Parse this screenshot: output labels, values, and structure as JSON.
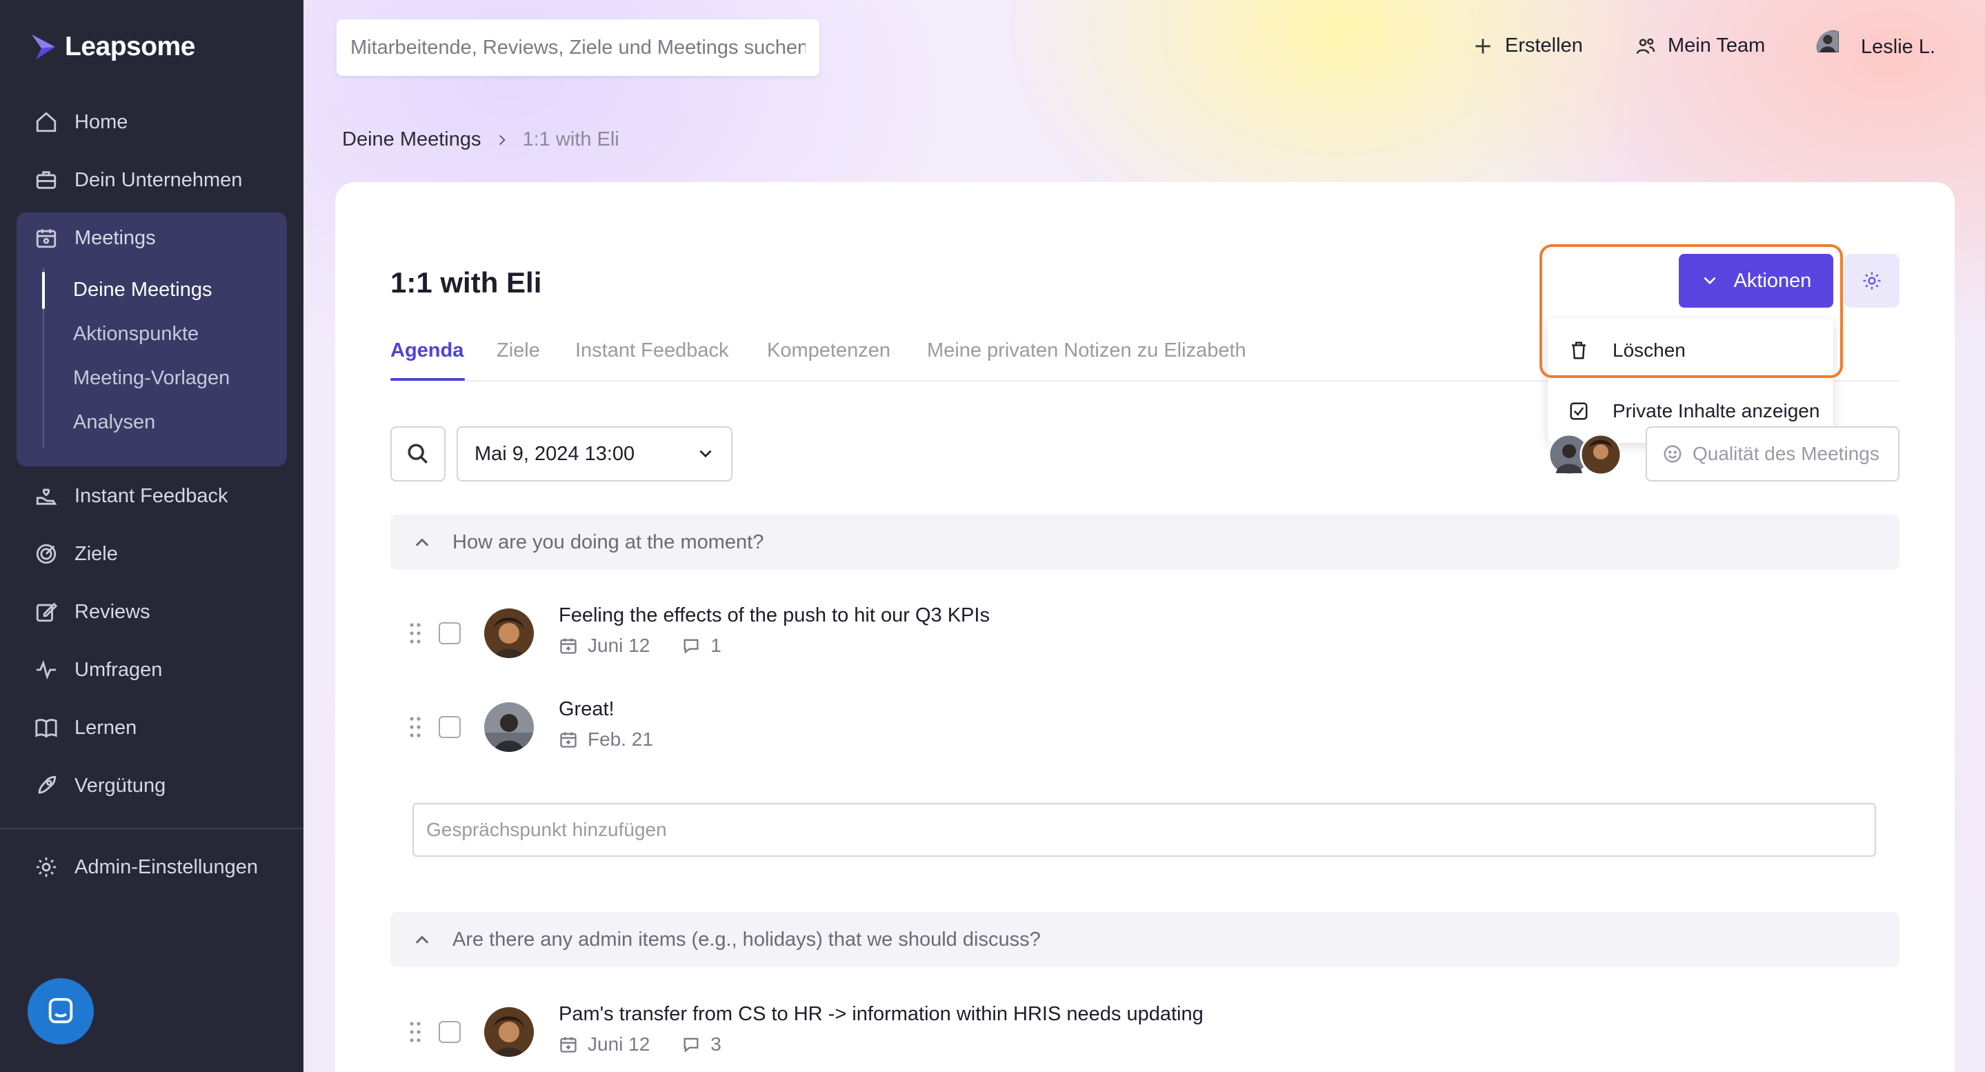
{
  "app": {
    "logo_text": "Leapsome"
  },
  "sidebar": {
    "items": [
      {
        "label": "Home",
        "icon": "home-icon"
      },
      {
        "label": "Dein Unternehmen",
        "icon": "briefcase-icon"
      },
      {
        "label": "Meetings",
        "icon": "calendar-people-icon"
      },
      {
        "label": "Instant Feedback",
        "icon": "hand-heart-icon"
      },
      {
        "label": "Ziele",
        "icon": "target-icon"
      },
      {
        "label": "Reviews",
        "icon": "edit-icon"
      },
      {
        "label": "Umfragen",
        "icon": "pulse-icon"
      },
      {
        "label": "Lernen",
        "icon": "book-icon"
      },
      {
        "label": "Vergütung",
        "icon": "rocket-icon"
      },
      {
        "label": "Admin-Einstellungen",
        "icon": "gear-icon"
      }
    ],
    "meetings_sub": [
      {
        "label": "Deine Meetings",
        "active": true
      },
      {
        "label": "Aktionspunkte",
        "active": false
      },
      {
        "label": "Meeting-Vorlagen",
        "active": false
      },
      {
        "label": "Analysen",
        "active": false
      }
    ]
  },
  "header": {
    "search_placeholder": "Mitarbeitende, Reviews, Ziele und Meetings suchen",
    "create_label": "Erstellen",
    "team_label": "Mein Team",
    "user_label": "Leslie L."
  },
  "breadcrumb": {
    "parent": "Deine Meetings",
    "current": "1:1 with Eli"
  },
  "page": {
    "title": "1:1 with Eli",
    "tabs": [
      {
        "label": "Agenda",
        "active": true
      },
      {
        "label": "Ziele",
        "active": false
      },
      {
        "label": "Instant Feedback",
        "active": false
      },
      {
        "label": "Kompetenzen",
        "active": false
      },
      {
        "label": "Meine privaten Notizen zu Elizabeth",
        "active": false
      }
    ],
    "actions_label": "Aktionen",
    "actions_menu": [
      {
        "label": "Löschen",
        "icon": "trash-icon"
      },
      {
        "label": "Private Inhalte anzeigen",
        "icon": "checkbox-checked-icon"
      }
    ],
    "date_value": "Mai 9, 2024 13:00",
    "quality_label": "Qualität des Meetings",
    "add_topic_placeholder": "Gesprächspunkt hinzufügen"
  },
  "sections": [
    {
      "title": "How are you doing at the moment?",
      "items": [
        {
          "title": "Feeling the effects of the push to hit our Q3 KPIs",
          "date": "Juni 12",
          "comments": "1"
        },
        {
          "title": "Great!",
          "date": "Feb. 21",
          "comments": ""
        }
      ]
    },
    {
      "title": "Are there any admin items (e.g., holidays) that we should discuss?",
      "items": [
        {
          "title": "Pam's transfer from CS to HR -> information within HRIS needs updating",
          "date": "Juni 12",
          "comments": "3"
        }
      ]
    }
  ],
  "colors": {
    "sidebar_bg": "#262838",
    "accent": "#5a45e0",
    "highlight": "#f07c2e",
    "chat_bubble": "#1f78d1"
  }
}
